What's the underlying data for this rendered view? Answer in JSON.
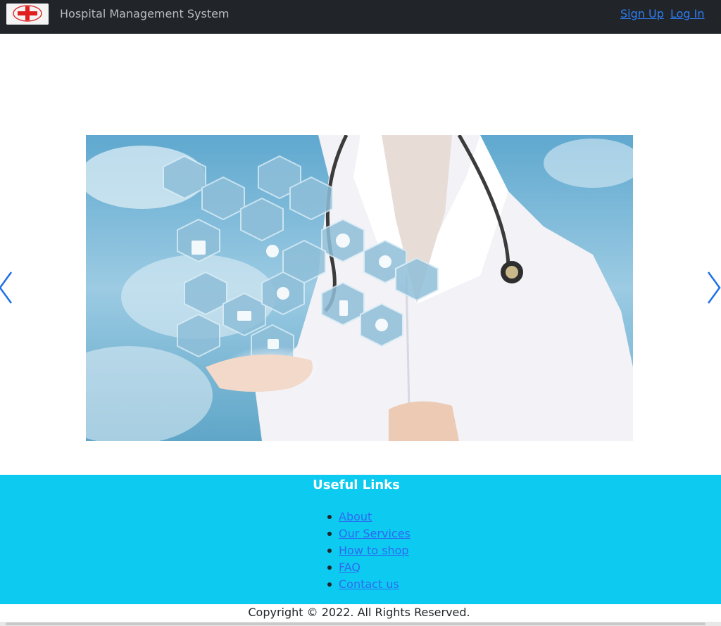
{
  "navbar": {
    "logo_icon": "red-cross-logo-icon",
    "brand": "Hospital Management System",
    "signup_label": "Sign Up",
    "login_label": "Log In"
  },
  "carousel": {
    "slide_image": "doctor-with-medical-icons-image",
    "prev_icon": "chevron-left-icon",
    "next_icon": "chevron-right-icon"
  },
  "useful_links": {
    "title": "Useful Links",
    "items": [
      {
        "label": "About"
      },
      {
        "label": "Our Services"
      },
      {
        "label": "How to shop"
      },
      {
        "label": "FAQ"
      },
      {
        "label": "Contact us"
      }
    ]
  },
  "footer": {
    "copyright": "Copyright © 2022. All Rights Reserved."
  },
  "colors": {
    "navbar_bg": "#212529",
    "link": "#2d7ef7",
    "links_section_bg": "#0dcaf0",
    "carousel_control": "#1f6fe8"
  }
}
